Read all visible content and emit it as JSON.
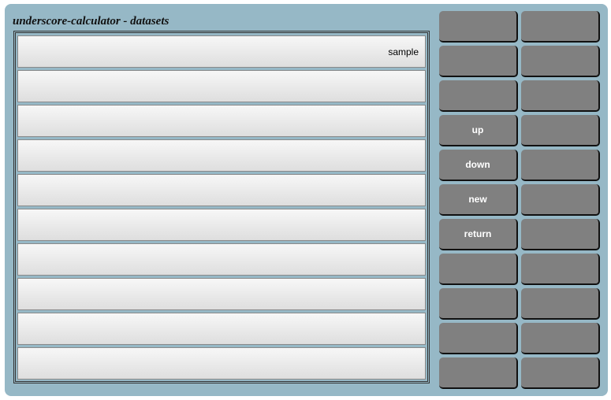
{
  "window": {
    "title": "underscore-calculator - datasets"
  },
  "datasets": {
    "rows": [
      "sample",
      "",
      "",
      "",
      "",
      "",
      "",
      "",
      "",
      ""
    ]
  },
  "buttons": {
    "left": [
      "",
      "",
      "",
      "up",
      "down",
      "new",
      "return",
      "",
      "",
      "",
      ""
    ],
    "right": [
      "",
      "",
      "",
      "",
      "",
      "",
      "",
      "",
      "",
      "",
      ""
    ]
  },
  "colors": {
    "frame": "#96b8c6",
    "button": "#808080",
    "button_text": "#ffffff",
    "row_top": "#f7f7f7",
    "row_bottom": "#dedede"
  }
}
